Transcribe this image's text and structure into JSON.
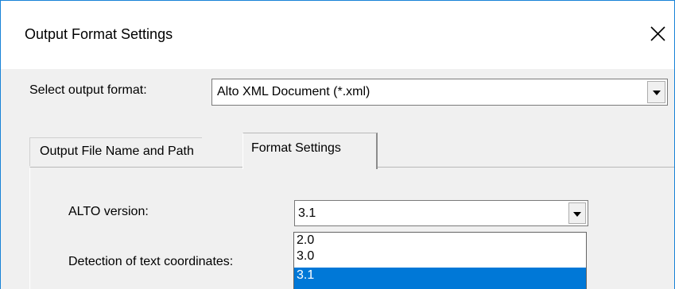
{
  "dialog": {
    "title": "Output Format Settings"
  },
  "output_format": {
    "label": "Select output format:",
    "selected": "Alto XML Document (*.xml)"
  },
  "tabs": [
    {
      "label": "Output File Name and Path",
      "active": false
    },
    {
      "label": "Format Settings",
      "active": true
    }
  ],
  "format_settings": {
    "alto_version": {
      "label": "ALTO version:",
      "selected": "3.1",
      "options": [
        "2.0",
        "3.0",
        "3.1"
      ]
    },
    "text_coordinates": {
      "label": "Detection of text coordinates:"
    }
  },
  "colors": {
    "window_border": "#1883d7",
    "selection_highlight": "#0078d7",
    "dialog_background": "#f0f0f0"
  },
  "icons": {
    "close": "close-icon",
    "dropdown": "chevron-down-icon"
  }
}
